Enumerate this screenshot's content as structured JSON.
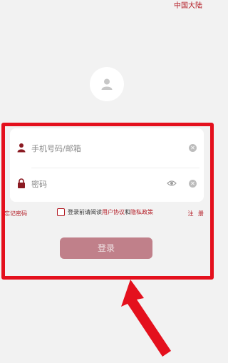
{
  "header": {
    "region_label": "中国大陆"
  },
  "form": {
    "phone_placeholder": "手机号码/邮箱",
    "password_placeholder": "密码"
  },
  "options": {
    "forgot_password": "忘记密码",
    "agree_prefix": "登录前请阅读",
    "user_agreement": "用户协议",
    "and": "和",
    "privacy_policy": "隐私政策",
    "register": "注 册"
  },
  "login_button": "登录",
  "colors": {
    "brand": "#b31b24",
    "annotation": "#e4101d",
    "button_disabled": "#c0808a"
  }
}
